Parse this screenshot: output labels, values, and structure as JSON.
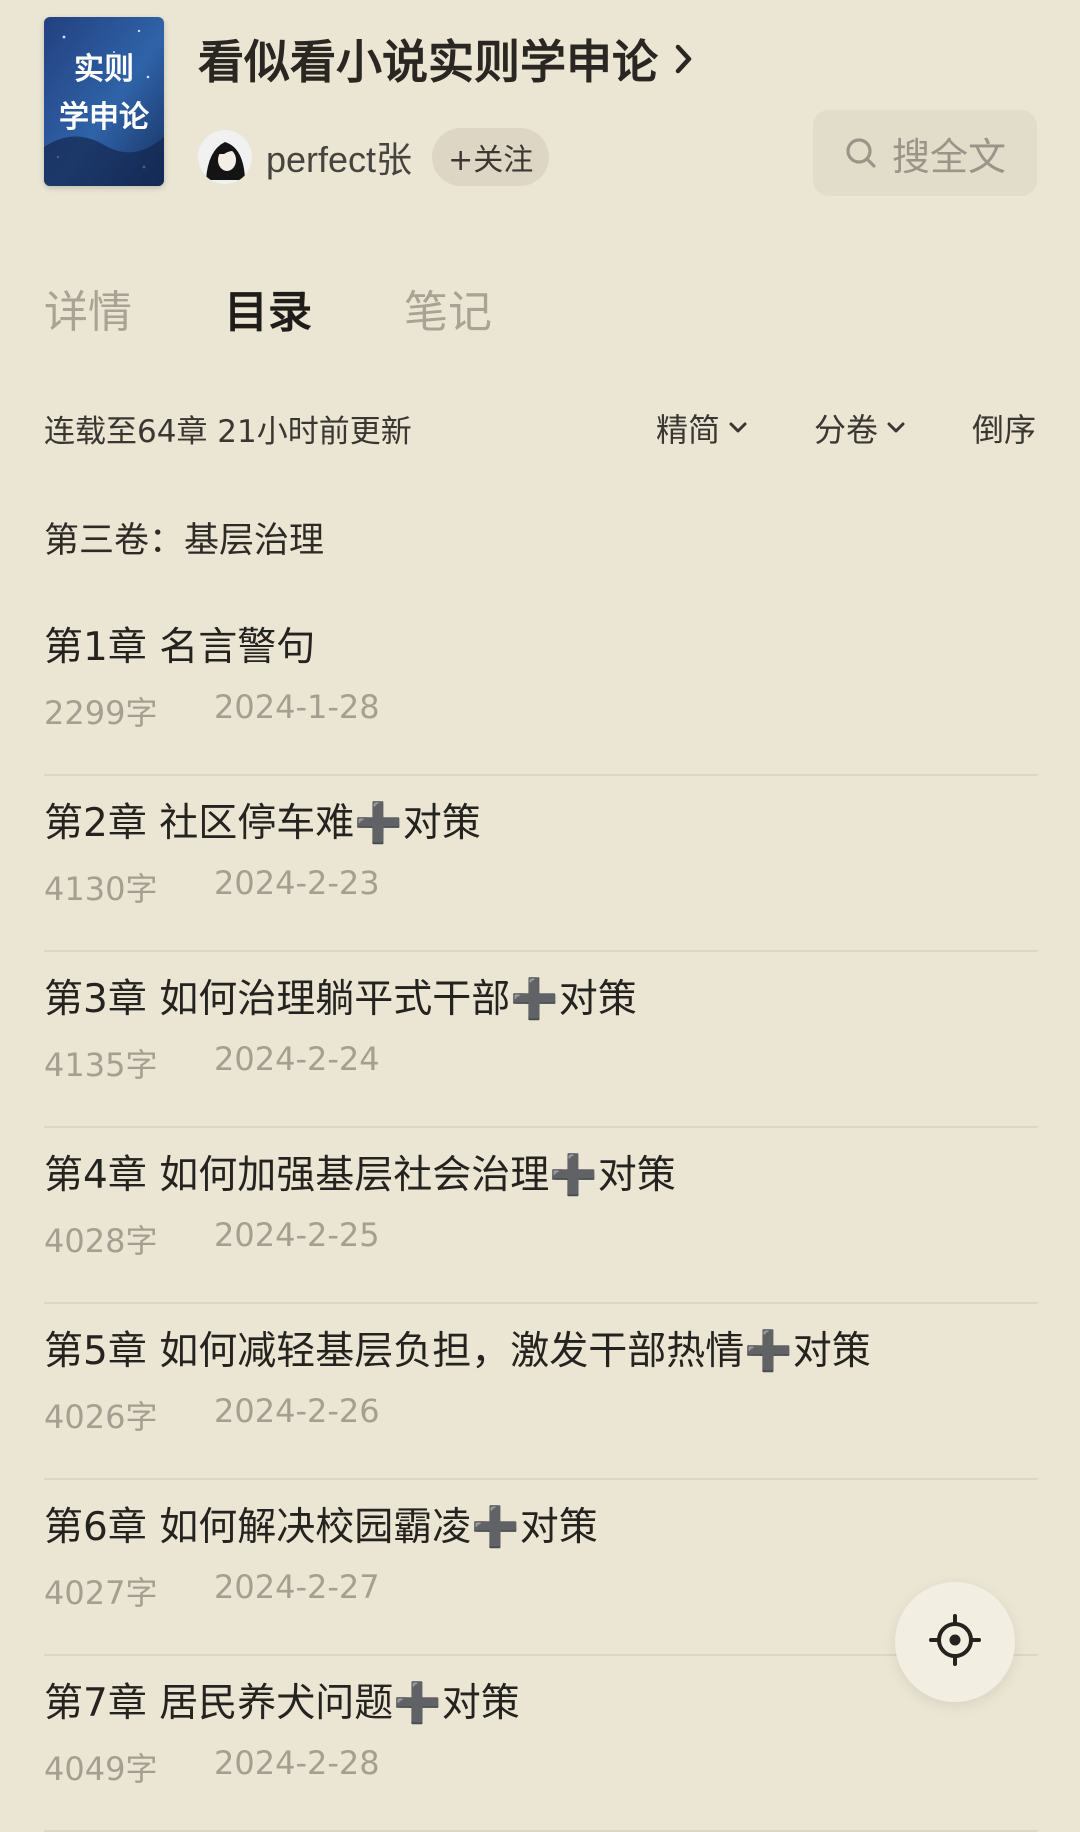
{
  "header": {
    "book_title": "看似看小说实则学申论",
    "author": "perfect张",
    "follow_label": "+关注",
    "search_label": "搜全文",
    "cover_text": "实则学申论"
  },
  "tabs": [
    {
      "label": "详情",
      "active": false
    },
    {
      "label": "目录",
      "active": true
    },
    {
      "label": "笔记",
      "active": false
    }
  ],
  "meta": {
    "update_text": "连载至64章 21小时前更新",
    "simple_label": "精简",
    "volume_label": "分卷",
    "order_label": "倒序"
  },
  "volume_title": "第三卷：基层治理",
  "chapters": [
    {
      "title": "第1章 名言警句",
      "words": "2299字",
      "date": "2024-1-28"
    },
    {
      "title": "第2章 社区停车难➕对策",
      "words": "4130字",
      "date": "2024-2-23"
    },
    {
      "title": "第3章 如何治理躺平式干部➕对策",
      "words": "4135字",
      "date": "2024-2-24"
    },
    {
      "title": "第4章 如何加强基层社会治理➕对策",
      "words": "4028字",
      "date": "2024-2-25"
    },
    {
      "title": "第5章 如何减轻基层负担，激发干部热情➕对策",
      "words": "4026字",
      "date": "2024-2-26"
    },
    {
      "title": "第6章 如何解决校园霸凌➕对策",
      "words": "4027字",
      "date": "2024-2-27"
    },
    {
      "title": "第7章 居民养犬问题➕对策",
      "words": "4049字",
      "date": "2024-2-28"
    }
  ],
  "icons": {
    "chevron_right": "chevron-right-icon",
    "search": "search-icon",
    "chevron_down": "chevron-down-icon",
    "locate": "locate-icon"
  },
  "colors": {
    "background": "#ebe5d3",
    "text_primary": "#25231f",
    "text_secondary": "#a49f91",
    "tab_inactive": "#a8a394"
  }
}
